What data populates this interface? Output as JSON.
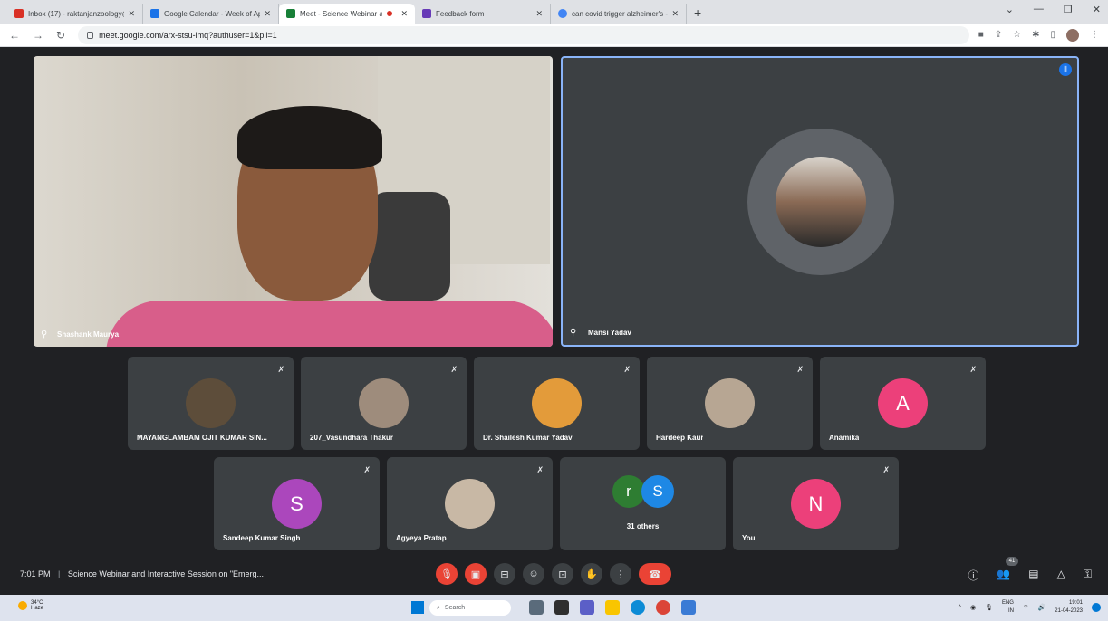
{
  "browser": {
    "tabs": [
      {
        "title": "Inbox (17) - raktanjanzoology@",
        "color": "#d93025"
      },
      {
        "title": "Google Calendar - Week of April",
        "color": "#1a73e8"
      },
      {
        "title": "Meet - Science Webinar and",
        "color": "#188038",
        "active": true
      },
      {
        "title": "Feedback form",
        "color": "#673ab7"
      },
      {
        "title": "can covid trigger alzheimer's - G",
        "color": "#4285f4"
      }
    ],
    "url": "meet.google.com/arx-stsu-imq?authuser=1&pli=1"
  },
  "meeting": {
    "main_tiles": [
      {
        "name": "Shashank Maurya"
      },
      {
        "name": "Mansi Yadav"
      }
    ],
    "participants_row1": [
      {
        "name": "MAYANGLAMBAM OJIT KUMAR SIN...",
        "avatar_color": "#5d4d3a"
      },
      {
        "name": "207_Vasundhara Thakur",
        "avatar_color": "#9e8c7c"
      },
      {
        "name": "Dr. Shailesh Kumar Yadav",
        "avatar_color": "#e39b3a"
      },
      {
        "name": "Hardeep Kaur",
        "avatar_color": "#b7a693"
      },
      {
        "name": "Anamika",
        "initial": "A",
        "avatar_color": "#ec407a"
      }
    ],
    "participants_row2": [
      {
        "name": "Sandeep Kumar Singh",
        "initial": "S",
        "avatar_color": "#ab47bc"
      },
      {
        "name": "Agyeya Pratap",
        "avatar_color": "#c8b8a5"
      },
      {
        "name": "31 others",
        "initials": [
          "r",
          "S"
        ],
        "colors": [
          "#2e7d32",
          "#1e88e5"
        ]
      },
      {
        "name": "You",
        "initial": "N",
        "avatar_color": "#ec407a"
      }
    ],
    "time": "7:01 PM",
    "title": "Science Webinar and Interactive Session on \"Emerg...",
    "participant_count": "41"
  },
  "taskbar": {
    "weather_temp": "34°C",
    "weather_desc": "Haze",
    "search_placeholder": "Search",
    "lang": "ENG",
    "region": "IN",
    "time": "19:01",
    "date": "21-04-2023"
  }
}
